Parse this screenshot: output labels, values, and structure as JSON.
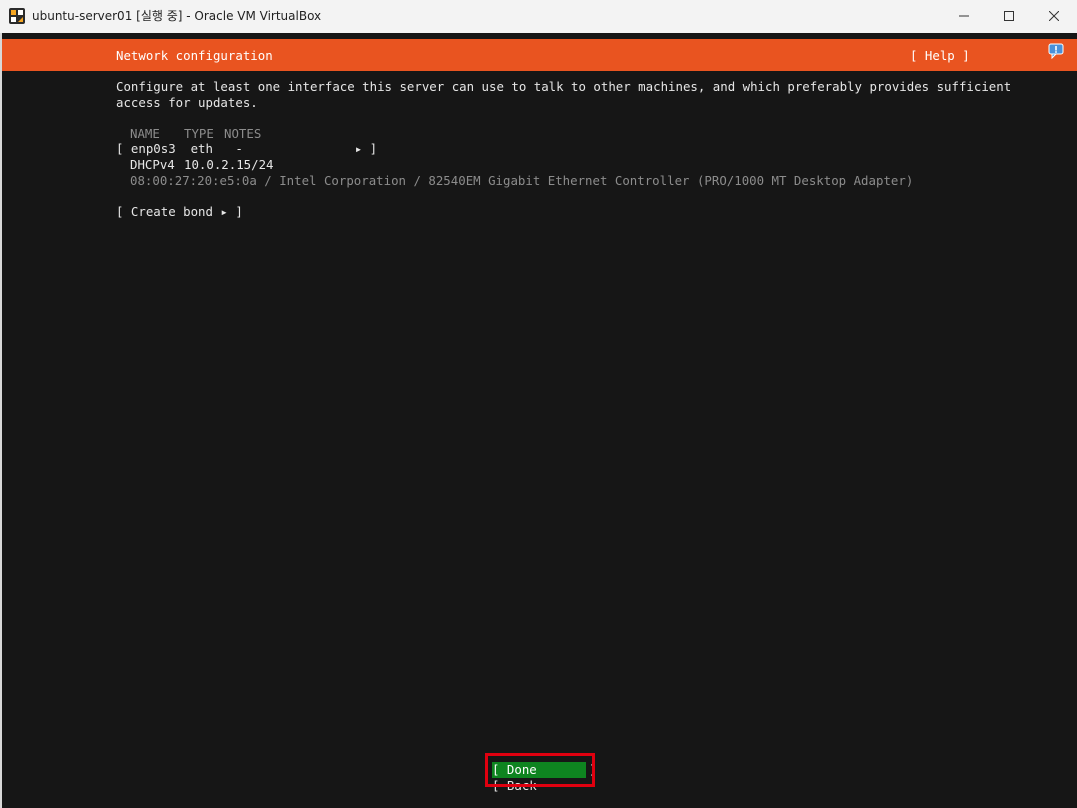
{
  "window": {
    "title": "ubuntu-server01 [실행 중] - Oracle VM VirtualBox",
    "app_icon": "virtualbox-icon",
    "controls": {
      "minimize": "minimize-icon",
      "maximize": "maximize-icon",
      "close": "close-icon"
    }
  },
  "installer": {
    "header": {
      "title": "Network configuration",
      "help": "[ Help ]"
    },
    "description": [
      "Configure at least one interface this server can use to talk to other machines, and which preferably provides sufficient",
      "access for updates."
    ],
    "table": {
      "columns": [
        "NAME",
        "TYPE",
        "NOTES"
      ],
      "interface": {
        "name": "enp0s3",
        "type": "eth",
        "notes": "-",
        "row_text": "[ enp0s3  eth   -               ▸ ]",
        "dhcp_label": "DHCPv4",
        "dhcp_value": "10.0.2.15/24",
        "hardware": "08:00:27:20:e5:0a / Intel Corporation / 82540EM Gigabit Ethernet Controller (PRO/1000 MT Desktop Adapter)"
      }
    },
    "create_bond": "[ Create bond ▸ ]",
    "buttons": {
      "done": "[ Done       ]",
      "back": "[ Back       ]"
    }
  },
  "colors": {
    "header_bg": "#e95420",
    "screen_bg": "#161616",
    "done_bg": "#0e8420",
    "highlight": "#e0000f"
  }
}
